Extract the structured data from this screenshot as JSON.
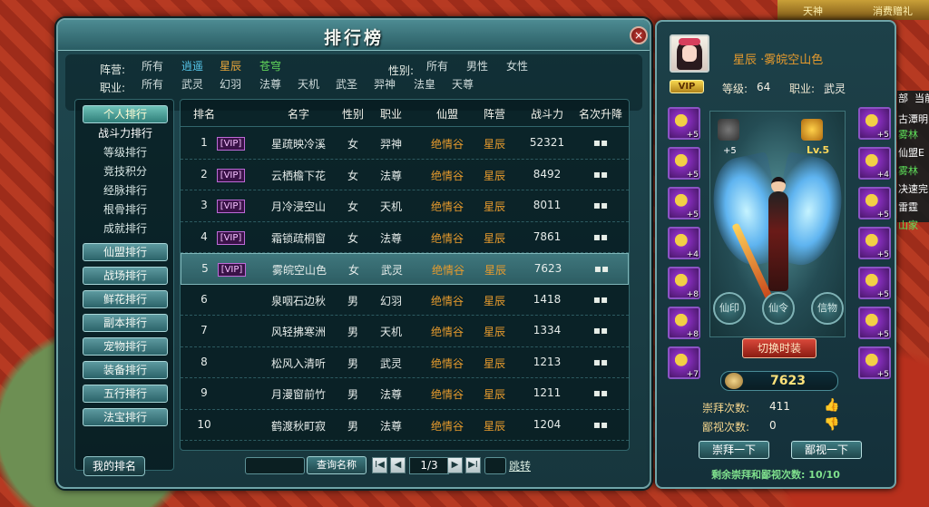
{
  "ranking_window": {
    "title": "排行榜",
    "close_label": "×",
    "filters": {
      "camp_label": "阵营:",
      "camp_options": [
        "所有",
        "逍遥",
        "星辰",
        "苍穹"
      ],
      "gender_label": "性别:",
      "gender_options": [
        "所有",
        "男性",
        "女性"
      ],
      "class_label": "职业:",
      "class_options": [
        "所有",
        "武灵",
        "幻羽",
        "法尊",
        "天机",
        "武圣",
        "羿神",
        "法皇",
        "天尊"
      ]
    },
    "sidebar": {
      "personal": "个人排行",
      "sub_items": [
        "战斗力排行",
        "等级排行",
        "竞技积分",
        "经脉排行",
        "根骨排行",
        "成就排行"
      ],
      "buttons": [
        "仙盟排行",
        "战场排行",
        "鲜花排行",
        "副本排行",
        "宠物排行",
        "装备排行",
        "五行排行",
        "法宝排行"
      ]
    },
    "table": {
      "headers": [
        "排名",
        "名字",
        "性别",
        "职业",
        "仙盟",
        "阵营",
        "战斗力",
        "名次升降"
      ],
      "rows": [
        {
          "rank": "1",
          "vip": "[VIP]",
          "name": "星疏映冷溪",
          "gender": "女",
          "class": "羿神",
          "alliance": "绝情谷",
          "camp": "星辰",
          "power": "52321",
          "move": "▪▪"
        },
        {
          "rank": "2",
          "vip": "[VIP]",
          "name": "云栖檐下花",
          "gender": "女",
          "class": "法尊",
          "alliance": "绝情谷",
          "camp": "星辰",
          "power": "8492",
          "move": "▪▪"
        },
        {
          "rank": "3",
          "vip": "[VIP]",
          "name": "月冷浸空山",
          "gender": "女",
          "class": "天机",
          "alliance": "绝情谷",
          "camp": "星辰",
          "power": "8011",
          "move": "▪▪"
        },
        {
          "rank": "4",
          "vip": "[VIP]",
          "name": "霜锁疏桐窗",
          "gender": "女",
          "class": "法尊",
          "alliance": "绝情谷",
          "camp": "星辰",
          "power": "7861",
          "move": "▪▪"
        },
        {
          "rank": "5",
          "vip": "[VIP]",
          "name": "雾皖空山色",
          "gender": "女",
          "class": "武灵",
          "alliance": "绝情谷",
          "camp": "星辰",
          "power": "7623",
          "move": "▪▪"
        },
        {
          "rank": "6",
          "vip": "",
          "name": "泉咽石边秋",
          "gender": "男",
          "class": "幻羽",
          "alliance": "绝情谷",
          "camp": "星辰",
          "power": "1418",
          "move": "▪▪"
        },
        {
          "rank": "7",
          "vip": "",
          "name": "风轻拂寒洲",
          "gender": "男",
          "class": "天机",
          "alliance": "绝情谷",
          "camp": "星辰",
          "power": "1334",
          "move": "▪▪"
        },
        {
          "rank": "8",
          "vip": "",
          "name": "松风入清听",
          "gender": "男",
          "class": "武灵",
          "alliance": "绝情谷",
          "camp": "星辰",
          "power": "1213",
          "move": "▪▪"
        },
        {
          "rank": "9",
          "vip": "",
          "name": "月漫窗前竹",
          "gender": "男",
          "class": "法尊",
          "alliance": "绝情谷",
          "camp": "星辰",
          "power": "1211",
          "move": "▪▪"
        },
        {
          "rank": "10",
          "vip": "",
          "name": "鹤渡秋町寂",
          "gender": "男",
          "class": "法尊",
          "alliance": "绝情谷",
          "camp": "星辰",
          "power": "1204",
          "move": "▪▪"
        }
      ]
    },
    "footer": {
      "my_rank": "我的排名",
      "search_button": "查询名称",
      "page": "1/3",
      "jump": "跳转",
      "first": "I◀",
      "prev": "◀",
      "next": "▶",
      "last": "▶I"
    }
  },
  "character_panel": {
    "name": "星辰 ·雾皖空山色",
    "vip": "VIP",
    "level_label": "等级:",
    "level_value": "64",
    "class_label": "职业:",
    "class_value": "武灵",
    "show_level": "Lv.5",
    "plus": "+5",
    "left_equip_levels": [
      "+5",
      "+5",
      "+5",
      "+4",
      "+8",
      "+8",
      "+7"
    ],
    "right_equip_levels": [
      "+5",
      "+4",
      "+5",
      "+5",
      "+5",
      "+5",
      "+5"
    ],
    "round_buttons": [
      "仙印",
      "仙令",
      "信物"
    ],
    "switch_button": "切换时装",
    "power": "7623",
    "worship_label": "崇拜次数:",
    "worship_value": "411",
    "despise_label": "鄙视次数:",
    "despise_value": "0",
    "worship_button": "崇拜一下",
    "despise_button": "鄙视一下",
    "remaining": "剩余崇拜和鄙视次数: 10/10"
  },
  "background": {
    "top_texts": [
      "天神",
      "消费赠礼"
    ],
    "side_texts": [
      "部",
      "当前",
      "古潭明",
      "雾林",
      "仙盟E",
      "雾林",
      "决速完",
      "雷霆",
      "山家"
    ]
  }
}
